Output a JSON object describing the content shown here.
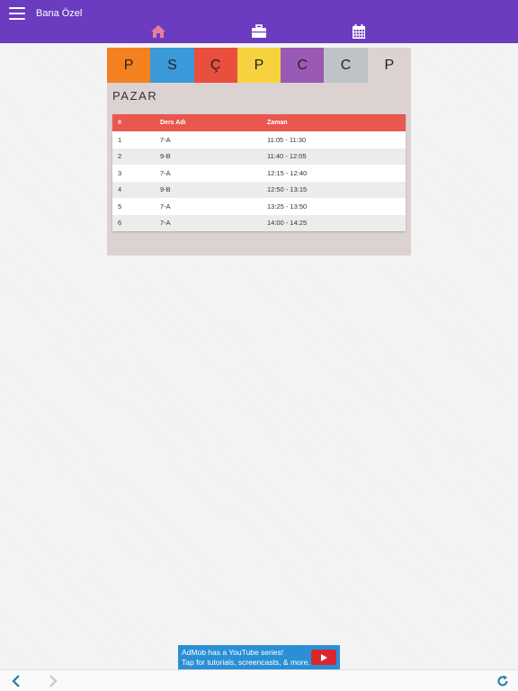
{
  "header": {
    "title": "Bana Özel",
    "menu_icon": "hamburger-icon",
    "nav_icons": [
      "home-icon",
      "briefcase-icon",
      "calendar-icon"
    ],
    "bg_color": "#6b3cbf",
    "active_icon_color": "#e87ca1"
  },
  "days": [
    {
      "letter": "P",
      "color": "#f4811f"
    },
    {
      "letter": "S",
      "color": "#3a9ad9"
    },
    {
      "letter": "Ç",
      "color": "#e94e3f"
    },
    {
      "letter": "P",
      "color": "#f6d23e"
    },
    {
      "letter": "C",
      "color": "#9b59b6"
    },
    {
      "letter": "C",
      "color": "#bdc3c7"
    },
    {
      "letter": "P",
      "color": "#ddd2d2"
    }
  ],
  "day_title": "PAZAR",
  "table": {
    "headers": [
      "#",
      "Ders Adı",
      "Zaman"
    ],
    "header_color": "#e9574f",
    "rows": [
      [
        "1",
        "7-A",
        "11:05 - 11:30"
      ],
      [
        "2",
        "9-B",
        "11:40 - 12:05"
      ],
      [
        "3",
        "7-A",
        "12:15 - 12:40"
      ],
      [
        "4",
        "9-B",
        "12:50 - 13:15"
      ],
      [
        "5",
        "7-A",
        "13:25 - 13:50"
      ],
      [
        "6",
        "7-A",
        "14:00 - 14:25"
      ]
    ]
  },
  "ad": {
    "line1": "AdMob has a YouTube series!",
    "line2": "Tap for tutorials, screencasts, & more."
  },
  "bottom_bar": {
    "icons": [
      "back-arrow-icon",
      "forward-arrow-icon",
      "refresh-icon"
    ]
  }
}
